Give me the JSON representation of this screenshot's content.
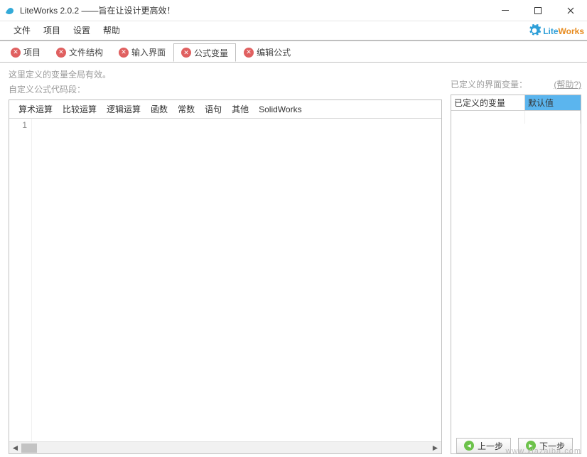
{
  "window": {
    "title": "LiteWorks 2.0.2 ——旨在让设计更高效！"
  },
  "brand": {
    "part1": "Lite",
    "part2": "Works"
  },
  "menu": {
    "file": "文件",
    "project": "项目",
    "settings": "设置",
    "help": "帮助"
  },
  "tabs": [
    {
      "label": "项目",
      "active": false
    },
    {
      "label": "文件结构",
      "active": false
    },
    {
      "label": "输入界面",
      "active": false
    },
    {
      "label": "公式变量",
      "active": true
    },
    {
      "label": "编辑公式",
      "active": false
    }
  ],
  "info": {
    "line1": "这里定义的变量全局有效。",
    "line2": "自定义公式代码段："
  },
  "toolbar": {
    "arith": "算术运算",
    "compare": "比较运算",
    "logic": "逻辑运算",
    "func": "函数",
    "const": "常数",
    "stmt": "语句",
    "other": "其他",
    "sw": "SolidWorks"
  },
  "editor": {
    "line_number": "1"
  },
  "rightpane": {
    "header": "已定义的界面变量：",
    "help": "(帮助?)",
    "col_var": "已定义的变量",
    "col_default": "默认值"
  },
  "nav": {
    "prev": "上一步",
    "next": "下一步"
  },
  "watermark": "www.xiazaiba.com"
}
